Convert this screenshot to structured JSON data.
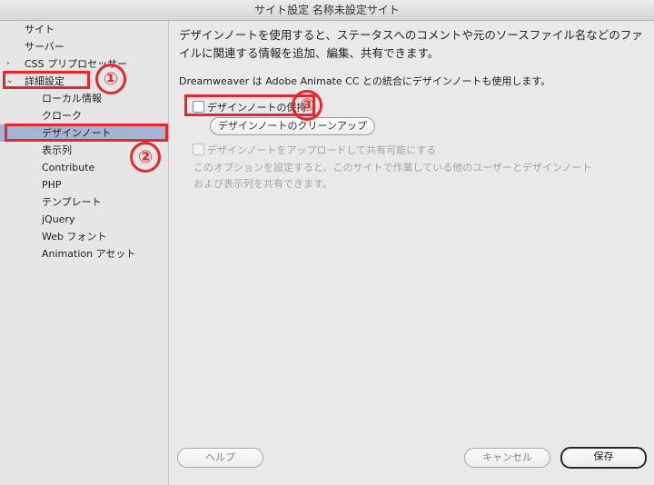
{
  "window": {
    "title": "サイト設定 名称未設定サイト"
  },
  "sidebar": {
    "items": [
      {
        "label": "サイト",
        "level": 0
      },
      {
        "label": "サーバー",
        "level": 0
      },
      {
        "label": "CSS プリプロセッサー",
        "level": 0,
        "chevron": "›"
      },
      {
        "label": "詳細設定",
        "level": 0,
        "chevron": "⌄"
      },
      {
        "label": "ローカル情報",
        "level": 1
      },
      {
        "label": "クローク",
        "level": 1
      },
      {
        "label": "デザインノート",
        "level": 1,
        "selected": true
      },
      {
        "label": "表示列",
        "level": 1
      },
      {
        "label": "Contribute",
        "level": 1
      },
      {
        "label": "PHP",
        "level": 1
      },
      {
        "label": "テンプレート",
        "level": 1
      },
      {
        "label": "jQuery",
        "level": 1
      },
      {
        "label": "Web フォント",
        "level": 1
      },
      {
        "label": "Animation アセット",
        "level": 1
      }
    ]
  },
  "main": {
    "description": "デザインノートを使用すると、ステータスへのコメントや元のソースファイル名などのファイルに関連する情報を追加、編集、共有できます。",
    "animate_note": "Dreamweaver は Adobe Animate CC との統合にデザインノートも使用します。",
    "maintain_checkbox": {
      "label": "デザインノートの保持",
      "checked": false
    },
    "cleanup_button": "デザインノートのクリーンアップ",
    "upload_checkbox": {
      "label": "デザインノートをアップロードして共有可能にする",
      "checked": false,
      "disabled": true
    },
    "upload_help_line1": "このオプションを設定すると、このサイトで作業している他のユーザーとデザインノート",
    "upload_help_line2": "および表示列を共有できます。"
  },
  "footer": {
    "help_label": "ヘルプ",
    "cancel_label": "キャンセル",
    "save_label": "保存"
  },
  "annotations": {
    "badge1": "①",
    "badge2": "②",
    "badge3": "③",
    "color": "#e8272c"
  }
}
